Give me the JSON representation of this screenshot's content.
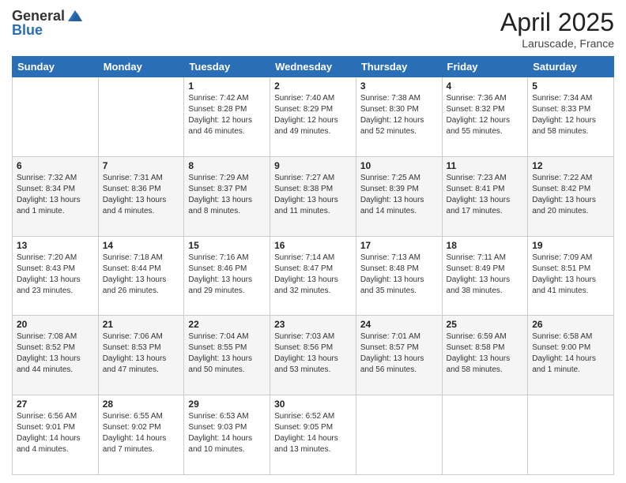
{
  "header": {
    "logo_general": "General",
    "logo_blue": "Blue",
    "month_title": "April 2025",
    "location": "Laruscade, France"
  },
  "columns": [
    "Sunday",
    "Monday",
    "Tuesday",
    "Wednesday",
    "Thursday",
    "Friday",
    "Saturday"
  ],
  "weeks": [
    {
      "days": [
        {
          "num": "",
          "info": ""
        },
        {
          "num": "",
          "info": ""
        },
        {
          "num": "1",
          "info": "Sunrise: 7:42 AM\nSunset: 8:28 PM\nDaylight: 12 hours and 46 minutes."
        },
        {
          "num": "2",
          "info": "Sunrise: 7:40 AM\nSunset: 8:29 PM\nDaylight: 12 hours and 49 minutes."
        },
        {
          "num": "3",
          "info": "Sunrise: 7:38 AM\nSunset: 8:30 PM\nDaylight: 12 hours and 52 minutes."
        },
        {
          "num": "4",
          "info": "Sunrise: 7:36 AM\nSunset: 8:32 PM\nDaylight: 12 hours and 55 minutes."
        },
        {
          "num": "5",
          "info": "Sunrise: 7:34 AM\nSunset: 8:33 PM\nDaylight: 12 hours and 58 minutes."
        }
      ]
    },
    {
      "days": [
        {
          "num": "6",
          "info": "Sunrise: 7:32 AM\nSunset: 8:34 PM\nDaylight: 13 hours and 1 minute."
        },
        {
          "num": "7",
          "info": "Sunrise: 7:31 AM\nSunset: 8:36 PM\nDaylight: 13 hours and 4 minutes."
        },
        {
          "num": "8",
          "info": "Sunrise: 7:29 AM\nSunset: 8:37 PM\nDaylight: 13 hours and 8 minutes."
        },
        {
          "num": "9",
          "info": "Sunrise: 7:27 AM\nSunset: 8:38 PM\nDaylight: 13 hours and 11 minutes."
        },
        {
          "num": "10",
          "info": "Sunrise: 7:25 AM\nSunset: 8:39 PM\nDaylight: 13 hours and 14 minutes."
        },
        {
          "num": "11",
          "info": "Sunrise: 7:23 AM\nSunset: 8:41 PM\nDaylight: 13 hours and 17 minutes."
        },
        {
          "num": "12",
          "info": "Sunrise: 7:22 AM\nSunset: 8:42 PM\nDaylight: 13 hours and 20 minutes."
        }
      ]
    },
    {
      "days": [
        {
          "num": "13",
          "info": "Sunrise: 7:20 AM\nSunset: 8:43 PM\nDaylight: 13 hours and 23 minutes."
        },
        {
          "num": "14",
          "info": "Sunrise: 7:18 AM\nSunset: 8:44 PM\nDaylight: 13 hours and 26 minutes."
        },
        {
          "num": "15",
          "info": "Sunrise: 7:16 AM\nSunset: 8:46 PM\nDaylight: 13 hours and 29 minutes."
        },
        {
          "num": "16",
          "info": "Sunrise: 7:14 AM\nSunset: 8:47 PM\nDaylight: 13 hours and 32 minutes."
        },
        {
          "num": "17",
          "info": "Sunrise: 7:13 AM\nSunset: 8:48 PM\nDaylight: 13 hours and 35 minutes."
        },
        {
          "num": "18",
          "info": "Sunrise: 7:11 AM\nSunset: 8:49 PM\nDaylight: 13 hours and 38 minutes."
        },
        {
          "num": "19",
          "info": "Sunrise: 7:09 AM\nSunset: 8:51 PM\nDaylight: 13 hours and 41 minutes."
        }
      ]
    },
    {
      "days": [
        {
          "num": "20",
          "info": "Sunrise: 7:08 AM\nSunset: 8:52 PM\nDaylight: 13 hours and 44 minutes."
        },
        {
          "num": "21",
          "info": "Sunrise: 7:06 AM\nSunset: 8:53 PM\nDaylight: 13 hours and 47 minutes."
        },
        {
          "num": "22",
          "info": "Sunrise: 7:04 AM\nSunset: 8:55 PM\nDaylight: 13 hours and 50 minutes."
        },
        {
          "num": "23",
          "info": "Sunrise: 7:03 AM\nSunset: 8:56 PM\nDaylight: 13 hours and 53 minutes."
        },
        {
          "num": "24",
          "info": "Sunrise: 7:01 AM\nSunset: 8:57 PM\nDaylight: 13 hours and 56 minutes."
        },
        {
          "num": "25",
          "info": "Sunrise: 6:59 AM\nSunset: 8:58 PM\nDaylight: 13 hours and 58 minutes."
        },
        {
          "num": "26",
          "info": "Sunrise: 6:58 AM\nSunset: 9:00 PM\nDaylight: 14 hours and 1 minute."
        }
      ]
    },
    {
      "days": [
        {
          "num": "27",
          "info": "Sunrise: 6:56 AM\nSunset: 9:01 PM\nDaylight: 14 hours and 4 minutes."
        },
        {
          "num": "28",
          "info": "Sunrise: 6:55 AM\nSunset: 9:02 PM\nDaylight: 14 hours and 7 minutes."
        },
        {
          "num": "29",
          "info": "Sunrise: 6:53 AM\nSunset: 9:03 PM\nDaylight: 14 hours and 10 minutes."
        },
        {
          "num": "30",
          "info": "Sunrise: 6:52 AM\nSunset: 9:05 PM\nDaylight: 14 hours and 13 minutes."
        },
        {
          "num": "",
          "info": ""
        },
        {
          "num": "",
          "info": ""
        },
        {
          "num": "",
          "info": ""
        }
      ]
    }
  ]
}
